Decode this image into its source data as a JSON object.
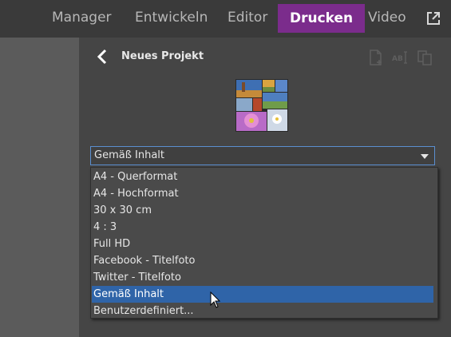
{
  "topnav": {
    "tabs": [
      {
        "label": "Manager"
      },
      {
        "label": "Entwickeln"
      },
      {
        "label": "Editor"
      },
      {
        "label": "Drucken"
      },
      {
        "label": "Video"
      }
    ],
    "active_tab": "Drucken",
    "export_icon": "external-link-icon"
  },
  "panel": {
    "title": "Neues Projekt",
    "back_icon": "chevron-left-icon",
    "toolbar_icons": [
      "new-page-icon",
      "rename-text-icon",
      "duplicate-icon"
    ]
  },
  "format_select": {
    "value": "Gemäß Inhalt",
    "options": [
      "A4 - Querformat",
      "A4 - Hochformat",
      "30 x 30 cm",
      "4 : 3",
      "Full HD",
      "Facebook - Titelfoto",
      "Twitter - Titelfoto",
      "Gemäß Inhalt",
      "Benutzerdefiniert..."
    ],
    "highlighted": "Gemäß Inhalt"
  },
  "colors": {
    "accent": "#7b2c8c",
    "selection": "#2f64a8",
    "focus_border": "#5b8fd0"
  }
}
